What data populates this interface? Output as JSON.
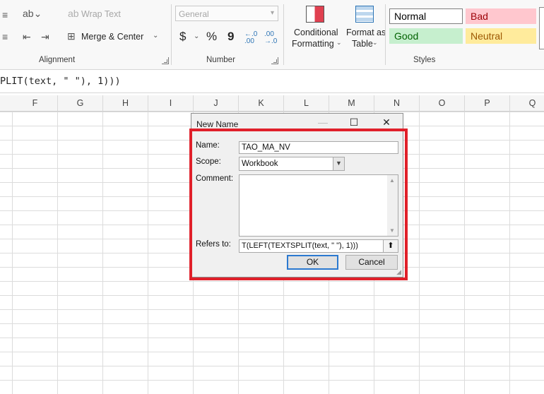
{
  "ribbon": {
    "alignment": {
      "label": "Alignment",
      "wrap_text": "Wrap Text",
      "merge_center": "Merge & Center",
      "icons": [
        "align-icon",
        "orientation-icon",
        "decrease-indent-icon",
        "increase-indent-icon",
        "wrap-text-icon",
        "merge-icon"
      ]
    },
    "number": {
      "label": "Number",
      "format_value": "General",
      "currency_symbol": "$",
      "percent_symbol": "%",
      "comma_symbol": "9",
      "increase_decimal": "←.0\n.00",
      "decrease_decimal": ".00\n→.0"
    },
    "styles": {
      "label": "Styles",
      "conditional_formatting": "Conditional",
      "conditional_formatting_2": "Formatting",
      "format_as_table": "Format as",
      "format_as_table_2": "Table",
      "cells": [
        {
          "name": "Normal",
          "bg": "#ffffff",
          "fg": "#000000",
          "border": "#7f7f7f"
        },
        {
          "name": "Bad",
          "bg": "#ffc7ce",
          "fg": "#9c0006",
          "border": "#ffc7ce"
        },
        {
          "name": "Good",
          "bg": "#c6efce",
          "fg": "#006100",
          "border": "#c6efce"
        },
        {
          "name": "Neutral",
          "bg": "#ffeb9c",
          "fg": "#9c5700",
          "border": "#ffeb9c"
        }
      ]
    }
  },
  "formula_bar": {
    "text": "PLIT(text, \" \"), 1)))"
  },
  "columns": [
    "F",
    "G",
    "H",
    "I",
    "J",
    "K",
    "L",
    "M",
    "N",
    "O",
    "P",
    "Q"
  ],
  "dialog": {
    "title": "New Name",
    "name_label": "Name:",
    "name_value": "TAO_MA_NV",
    "scope_label": "Scope:",
    "scope_value": "Workbook",
    "comment_label": "Comment:",
    "comment_value": "",
    "refers_label": "Refers to:",
    "refers_value": "T(LEFT(TEXTSPLIT(text, \" \"), 1)))",
    "ok_label": "OK",
    "cancel_label": "Cancel"
  },
  "accent_colors": {
    "highlight": "#e0202a"
  }
}
